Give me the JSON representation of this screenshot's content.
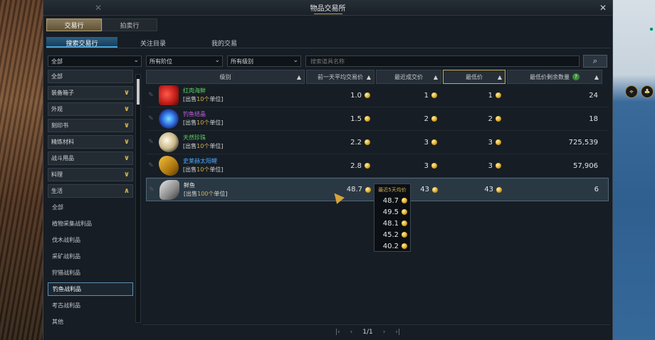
{
  "window": {
    "title": "物品交易所"
  },
  "top_tabs": [
    {
      "label": "交易行",
      "active": true
    },
    {
      "label": "拍卖行",
      "active": false
    }
  ],
  "sub_tabs": [
    {
      "label": "搜索交易行",
      "active": true
    },
    {
      "label": "关注目录",
      "active": false
    },
    {
      "label": "我的交易",
      "active": false
    }
  ],
  "filters": {
    "category": "全部",
    "tier": "所有阶位",
    "grade": "所有级别",
    "search_placeholder": "搜索道具名称"
  },
  "sidebar": {
    "items": [
      {
        "label": "全部",
        "expandable": false
      },
      {
        "label": "装备箱子",
        "expandable": true
      },
      {
        "label": "外观",
        "expandable": true
      },
      {
        "label": "刻印书",
        "expandable": true
      },
      {
        "label": "精炼材料",
        "expandable": true
      },
      {
        "label": "战斗用品",
        "expandable": true
      },
      {
        "label": "料理",
        "expandable": true
      },
      {
        "label": "生活",
        "expandable": true,
        "expanded": true
      }
    ],
    "sub_items": [
      {
        "label": "全部"
      },
      {
        "label": "植物采集战利品"
      },
      {
        "label": "伐木战利品"
      },
      {
        "label": "采矿战利品"
      },
      {
        "label": "狩猎战利品"
      },
      {
        "label": "钓鱼战利品",
        "selected": true
      },
      {
        "label": "考古战利品"
      },
      {
        "label": "其他"
      }
    ]
  },
  "table": {
    "headers": [
      "级别",
      "前一天平均交易价",
      "最近成交价",
      "最低价",
      "最低价剩余数量"
    ],
    "rows": [
      {
        "name": "红肉海鲜",
        "name_color": "#5fd65f",
        "sell_prefix": "[出售",
        "sell_qty": "10个",
        "sell_suffix": "单位]",
        "avg": "1.0",
        "recent": "1",
        "low": "1",
        "qty": "24",
        "icon": "meat-icon"
      },
      {
        "name": "钓鱼结晶",
        "name_color": "#c060e0",
        "sell_prefix": "[出售",
        "sell_qty": "10个",
        "sell_suffix": "单位]",
        "avg": "1.5",
        "recent": "2",
        "low": "2",
        "qty": "18",
        "icon": "crystal-icon"
      },
      {
        "name": "天然珍珠",
        "name_color": "#5fd65f",
        "sell_prefix": "[出售",
        "sell_qty": "10个",
        "sell_suffix": "单位]",
        "avg": "2.2",
        "recent": "3",
        "low": "3",
        "qty": "725,539",
        "icon": "pearl-icon"
      },
      {
        "name": "史莱赫太阳鲤",
        "name_color": "#4aa8ff",
        "sell_prefix": "[出售",
        "sell_qty": "10个",
        "sell_suffix": "单位]",
        "avg": "2.8",
        "recent": "3",
        "low": "3",
        "qty": "57,906",
        "icon": "golden-fish-icon"
      },
      {
        "name": "鲜鱼",
        "name_color": "#e6e6e6",
        "sell_prefix": "[出售",
        "sell_qty": "100个",
        "sell_suffix": "单位]",
        "avg": "48.7",
        "recent": "43",
        "low": "43",
        "qty": "6",
        "icon": "fresh-fish-icon",
        "selected": true
      }
    ]
  },
  "tooltip": {
    "title": "最近5天均价",
    "values": [
      "48.7",
      "49.5",
      "48.1",
      "45.2",
      "40.2"
    ]
  },
  "pager": {
    "page": "1/1"
  },
  "colors": {
    "accent_gold": "#d6b34e",
    "tab_blue": "#2a5f85",
    "coin": "#d8a21c"
  }
}
